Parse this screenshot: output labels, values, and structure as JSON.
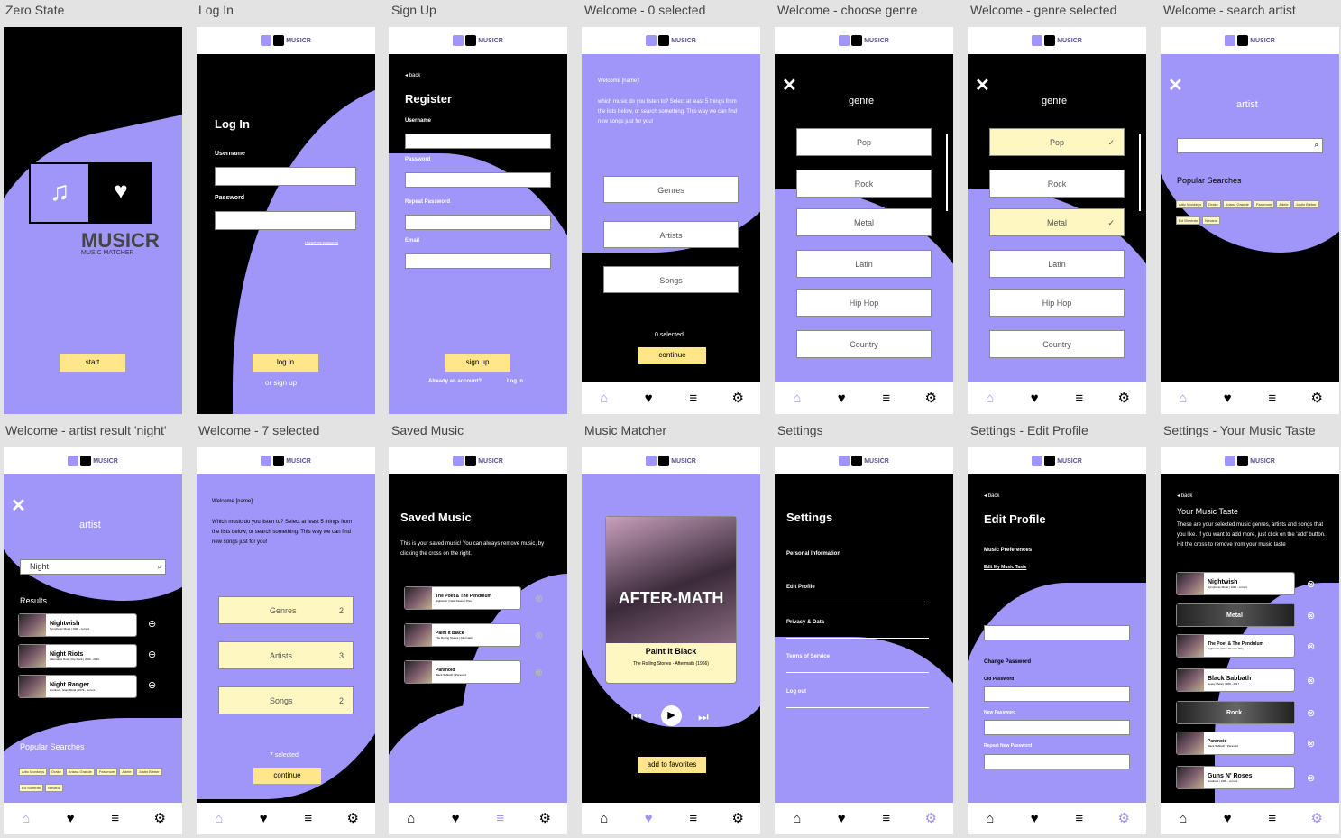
{
  "labels": [
    "Zero State",
    "Log In",
    "Sign Up",
    "Welcome - 0 selected",
    "Welcome - choose genre",
    "Welcome - genre selected",
    "Welcome - search artist",
    "Welcome - artist result 'night'",
    "Welcome - 7 selected",
    "Saved Music",
    "Music Matcher",
    "Settings",
    "Settings - Edit Profile",
    "Settings - Your Music Taste"
  ],
  "brand": {
    "name": "MUSICR",
    "tagline": "MUSIC MATCHER"
  },
  "nav_icons": [
    "home-icon",
    "heart-music-icon",
    "playlist-check-icon",
    "gear-icon"
  ],
  "colors": {
    "purple": "#a095f8",
    "yellow": "#ffe68a",
    "light_yellow": "#fff7c2"
  },
  "zero": {
    "start": "start"
  },
  "login": {
    "title": "Log In",
    "username": "Username",
    "password": "Password",
    "forgot": "I forgot my password",
    "button": "log in",
    "signup": "or sign up"
  },
  "signup": {
    "back": "back",
    "title": "Register",
    "username": "Username",
    "password": "Password",
    "repeat": "Repeat Password",
    "email": "Email",
    "button": "sign up",
    "already": "Already an account?",
    "login": "Log In"
  },
  "welcome": {
    "greeting": "Welcome [name]!",
    "intro": "which music do you listen to? Select at least 5 things from the lists below, or search something. This way we can find new songs just for you!",
    "genres": "Genres",
    "artists": "Artists",
    "songs": "Songs",
    "count": "0 selected",
    "continue": "continue"
  },
  "genre": {
    "title": "genre",
    "items": [
      "Pop",
      "Rock",
      "Metal",
      "Latin",
      "Hip Hop",
      "Country"
    ]
  },
  "artist": {
    "title": "artist",
    "popular": "Popular Searches",
    "tags": [
      "Artic Monkeys",
      "Drake",
      "Ariana Grande",
      "Paramore",
      "Adele",
      "Justin Bieber",
      "Ed Sheeran",
      "Nirvana"
    ],
    "query": "Night",
    "results": "Results",
    "results_list": [
      {
        "name": "Nightwish",
        "info": "Symphonic Metal | 1996 - current"
      },
      {
        "name": "Night Riots",
        "info": "Alternative Rock, Pop Rock | 2009 - 2020"
      },
      {
        "name": "Night Ranger",
        "info": "Hardrock, Glam Metal | 1979 - current"
      }
    ]
  },
  "seven": {
    "greeting": "Welcome [name]!",
    "intro": "Which music do you listen to? Select at least 5 things from the lists below, or search something. This way we can find new songs just for you!",
    "genres": "Genres",
    "genres_n": "2",
    "artists": "Artists",
    "artists_n": "3",
    "songs": "Songs",
    "songs_n": "2",
    "count": "7 selected",
    "continue": "continue"
  },
  "saved": {
    "title": "Saved Music",
    "desc": "This is your saved music! You can always remove music, by clicking the cross on the right.",
    "items": [
      {
        "name": "The Poet & The Pendulum",
        "info": "Nightwish | Dark Passion Play"
      },
      {
        "name": "Paint It Black",
        "info": "The Rolling Stones | Aftermath"
      },
      {
        "name": "Paranoid",
        "info": "Black Sabbath | Paranoid"
      }
    ]
  },
  "matcher": {
    "cover": "AFTER-MATH",
    "song": "Paint It Black",
    "info": "The Rolling Stones - Aftermath (1966)",
    "fav": "add to favorites"
  },
  "settings": {
    "title": "Settings",
    "items": [
      "Personal Information",
      "Edit Profile",
      "Privacy & Data",
      "Terms of Service",
      "Log out"
    ]
  },
  "edit": {
    "back": "back",
    "title": "Edit Profile",
    "prefs": "Music Preferences",
    "taste": "Edit My Music Taste",
    "change_email": "Change Email",
    "email": "Email",
    "change_pw": "Change Password",
    "old": "Old Password",
    "new": "New Password",
    "repeat": "Repeat New Password"
  },
  "taste": {
    "back": "back",
    "title": "Your Music Taste",
    "desc": "These are your selected music genres, artists and songs that you like. If you want to add more, just click on the 'add' button. Hit the cross to remove from your music taste",
    "items": [
      {
        "name": "Nightwish",
        "info": "Symphonic Metal | 1996 - current"
      },
      {
        "name": "Metal",
        "info": ""
      },
      {
        "name": "The Poet & The Pendulum",
        "info": "Nightwish | Dark Passion Play"
      },
      {
        "name": "Black Sabbath",
        "info": "Heavy Metal | 1968 - 2017"
      },
      {
        "name": "Rock",
        "info": ""
      },
      {
        "name": "Paranoid",
        "info": "Black Sabbath | Paranoid"
      },
      {
        "name": "Guns N' Roses",
        "info": "Hardrock | 1985 - current"
      }
    ]
  }
}
